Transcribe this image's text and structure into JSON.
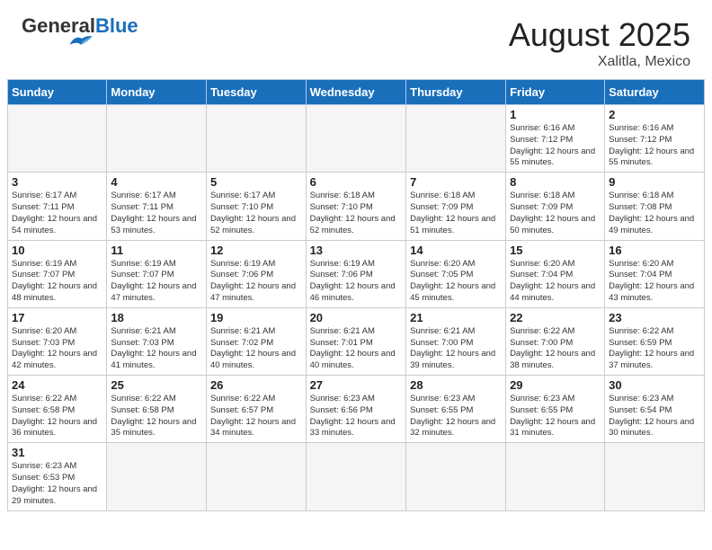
{
  "header": {
    "logo_general": "General",
    "logo_blue": "Blue",
    "month_year": "August 2025",
    "location": "Xalitla, Mexico"
  },
  "weekdays": [
    "Sunday",
    "Monday",
    "Tuesday",
    "Wednesday",
    "Thursday",
    "Friday",
    "Saturday"
  ],
  "weeks": [
    [
      {
        "day": "",
        "info": ""
      },
      {
        "day": "",
        "info": ""
      },
      {
        "day": "",
        "info": ""
      },
      {
        "day": "",
        "info": ""
      },
      {
        "day": "",
        "info": ""
      },
      {
        "day": "1",
        "info": "Sunrise: 6:16 AM\nSunset: 7:12 PM\nDaylight: 12 hours\nand 55 minutes."
      },
      {
        "day": "2",
        "info": "Sunrise: 6:16 AM\nSunset: 7:12 PM\nDaylight: 12 hours\nand 55 minutes."
      }
    ],
    [
      {
        "day": "3",
        "info": "Sunrise: 6:17 AM\nSunset: 7:11 PM\nDaylight: 12 hours\nand 54 minutes."
      },
      {
        "day": "4",
        "info": "Sunrise: 6:17 AM\nSunset: 7:11 PM\nDaylight: 12 hours\nand 53 minutes."
      },
      {
        "day": "5",
        "info": "Sunrise: 6:17 AM\nSunset: 7:10 PM\nDaylight: 12 hours\nand 52 minutes."
      },
      {
        "day": "6",
        "info": "Sunrise: 6:18 AM\nSunset: 7:10 PM\nDaylight: 12 hours\nand 52 minutes."
      },
      {
        "day": "7",
        "info": "Sunrise: 6:18 AM\nSunset: 7:09 PM\nDaylight: 12 hours\nand 51 minutes."
      },
      {
        "day": "8",
        "info": "Sunrise: 6:18 AM\nSunset: 7:09 PM\nDaylight: 12 hours\nand 50 minutes."
      },
      {
        "day": "9",
        "info": "Sunrise: 6:18 AM\nSunset: 7:08 PM\nDaylight: 12 hours\nand 49 minutes."
      }
    ],
    [
      {
        "day": "10",
        "info": "Sunrise: 6:19 AM\nSunset: 7:07 PM\nDaylight: 12 hours\nand 48 minutes."
      },
      {
        "day": "11",
        "info": "Sunrise: 6:19 AM\nSunset: 7:07 PM\nDaylight: 12 hours\nand 47 minutes."
      },
      {
        "day": "12",
        "info": "Sunrise: 6:19 AM\nSunset: 7:06 PM\nDaylight: 12 hours\nand 47 minutes."
      },
      {
        "day": "13",
        "info": "Sunrise: 6:19 AM\nSunset: 7:06 PM\nDaylight: 12 hours\nand 46 minutes."
      },
      {
        "day": "14",
        "info": "Sunrise: 6:20 AM\nSunset: 7:05 PM\nDaylight: 12 hours\nand 45 minutes."
      },
      {
        "day": "15",
        "info": "Sunrise: 6:20 AM\nSunset: 7:04 PM\nDaylight: 12 hours\nand 44 minutes."
      },
      {
        "day": "16",
        "info": "Sunrise: 6:20 AM\nSunset: 7:04 PM\nDaylight: 12 hours\nand 43 minutes."
      }
    ],
    [
      {
        "day": "17",
        "info": "Sunrise: 6:20 AM\nSunset: 7:03 PM\nDaylight: 12 hours\nand 42 minutes."
      },
      {
        "day": "18",
        "info": "Sunrise: 6:21 AM\nSunset: 7:03 PM\nDaylight: 12 hours\nand 41 minutes."
      },
      {
        "day": "19",
        "info": "Sunrise: 6:21 AM\nSunset: 7:02 PM\nDaylight: 12 hours\nand 40 minutes."
      },
      {
        "day": "20",
        "info": "Sunrise: 6:21 AM\nSunset: 7:01 PM\nDaylight: 12 hours\nand 40 minutes."
      },
      {
        "day": "21",
        "info": "Sunrise: 6:21 AM\nSunset: 7:00 PM\nDaylight: 12 hours\nand 39 minutes."
      },
      {
        "day": "22",
        "info": "Sunrise: 6:22 AM\nSunset: 7:00 PM\nDaylight: 12 hours\nand 38 minutes."
      },
      {
        "day": "23",
        "info": "Sunrise: 6:22 AM\nSunset: 6:59 PM\nDaylight: 12 hours\nand 37 minutes."
      }
    ],
    [
      {
        "day": "24",
        "info": "Sunrise: 6:22 AM\nSunset: 6:58 PM\nDaylight: 12 hours\nand 36 minutes."
      },
      {
        "day": "25",
        "info": "Sunrise: 6:22 AM\nSunset: 6:58 PM\nDaylight: 12 hours\nand 35 minutes."
      },
      {
        "day": "26",
        "info": "Sunrise: 6:22 AM\nSunset: 6:57 PM\nDaylight: 12 hours\nand 34 minutes."
      },
      {
        "day": "27",
        "info": "Sunrise: 6:23 AM\nSunset: 6:56 PM\nDaylight: 12 hours\nand 33 minutes."
      },
      {
        "day": "28",
        "info": "Sunrise: 6:23 AM\nSunset: 6:55 PM\nDaylight: 12 hours\nand 32 minutes."
      },
      {
        "day": "29",
        "info": "Sunrise: 6:23 AM\nSunset: 6:55 PM\nDaylight: 12 hours\nand 31 minutes."
      },
      {
        "day": "30",
        "info": "Sunrise: 6:23 AM\nSunset: 6:54 PM\nDaylight: 12 hours\nand 30 minutes."
      }
    ],
    [
      {
        "day": "31",
        "info": "Sunrise: 6:23 AM\nSunset: 6:53 PM\nDaylight: 12 hours\nand 29 minutes."
      },
      {
        "day": "",
        "info": ""
      },
      {
        "day": "",
        "info": ""
      },
      {
        "day": "",
        "info": ""
      },
      {
        "day": "",
        "info": ""
      },
      {
        "day": "",
        "info": ""
      },
      {
        "day": "",
        "info": ""
      }
    ]
  ]
}
